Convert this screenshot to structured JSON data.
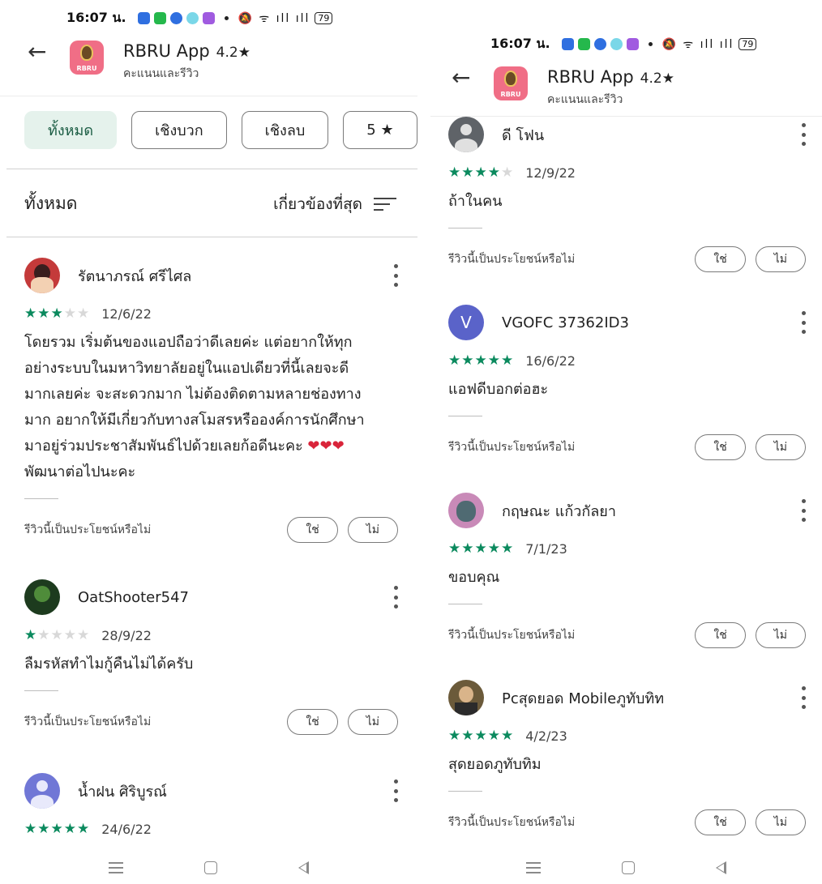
{
  "status": {
    "time": "16:07 น.",
    "battery": "79"
  },
  "app": {
    "name": "RBRU App",
    "rating": "4.2★",
    "subtitle": "คะแนนและรีวิว",
    "logo_text": "RBRU"
  },
  "filters": [
    "ทั้งหมด",
    "เชิงบวก",
    "เชิงลบ",
    "5 ★"
  ],
  "sort": {
    "title": "ทั้งหมด",
    "label": "เกี่ยวข้องที่สุด"
  },
  "helpful": {
    "question": "รีวิวนี้เป็นประโยชน์หรือไม่",
    "yes": "ใช่",
    "no": "ไม่"
  },
  "colors": {
    "star": "#0b8a5e",
    "chip_active": "#e5f2ec"
  },
  "left_reviews": [
    {
      "name": "รัตนาภรณ์ ศรีไศล",
      "stars": 3,
      "date": "12/6/22",
      "text": "โดยรวม เริ่มต้นของแอปถือว่าดีเลยค่ะ แต่อยากให้ทุก\nอย่างระบบในมหาวิทยาลัยอยู่ในแอปเดียวที่นี้เลยจะดี\nมากเลยค่ะ จะสะดวกมาก ไม่ต้องติดตามหลายช่องทาง\nมาก อยากให้มีเกี่ยวกับทางสโมสรหรือองค์การนักศึกษา\nมาอยู่ร่วมประชาสัมพันธ์ไปด้วยเลยก้อดีนะคะ ",
      "text_end": "\nพัฒนาต่อไปนะคะ",
      "hearts": "❤❤❤"
    },
    {
      "name": "OatShooter547",
      "stars": 1,
      "date": "28/9/22",
      "text": "ลืมรหัสทำไมกู้คืนไม่ได้ครับ"
    },
    {
      "name": "น้ำฝน ศิริบูรณ์",
      "stars": 5,
      "date": "24/6/22"
    }
  ],
  "right_reviews": [
    {
      "name": "ดี โฟน",
      "stars": 4,
      "date": "12/9/22",
      "text": "ถ้าในคน"
    },
    {
      "name": "VGOFC 37362ID3",
      "avatar_letter": "V",
      "stars": 5,
      "date": "16/6/22",
      "text": "แอฟดีบอกต่อฮะ"
    },
    {
      "name": "กฤษณะ แก้วกัลยา",
      "stars": 5,
      "date": "7/1/23",
      "text": "ขอบคุณ"
    },
    {
      "name": "Pcสุดยอด Mobileภูทับทิท",
      "stars": 5,
      "date": "4/2/23",
      "text": "สุดยอดภูทับทิม"
    }
  ]
}
